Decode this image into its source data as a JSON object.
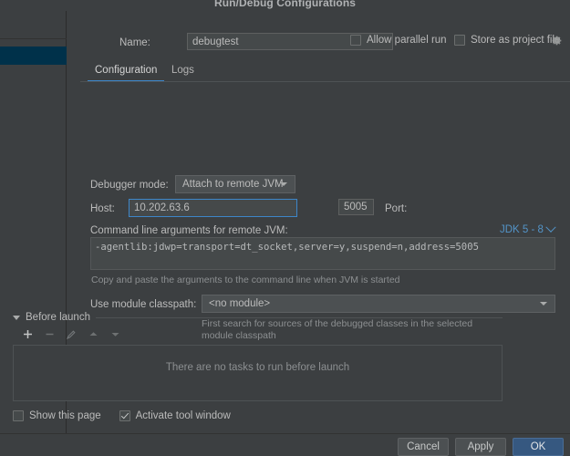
{
  "dialog": {
    "title": "Run/Debug Configurations"
  },
  "header": {
    "name_label": "Name:",
    "name_value": "debugtest",
    "allow_parallel_run_label": "Allow parallel run",
    "allow_parallel_run_checked": false,
    "store_as_project_file_label": "Store as project file",
    "store_as_project_file_checked": false,
    "gear_icon": "gear-icon"
  },
  "tabs": [
    {
      "label": "Configuration",
      "active": true
    },
    {
      "label": "Logs",
      "active": false
    }
  ],
  "form": {
    "debugger_mode_label": "Debugger mode:",
    "debugger_mode_value": "Attach to remote JVM",
    "host_label": "Host:",
    "host_value": "10.202.63.6",
    "port_label": "Port:",
    "port_value": "5005",
    "command_line_label": "Command line arguments for remote JVM:",
    "jdk_selector_label": "JDK 5 - 8",
    "command_line_value": "-agentlib:jdwp=transport=dt_socket,server=y,suspend=n,address=5005",
    "command_line_hint": "Copy and paste the arguments to the command line when JVM is started",
    "module_classpath_label": "Use module classpath:",
    "module_classpath_value": "<no module>",
    "module_classpath_hint": "First search for sources of the debugged classes in the selected module classpath"
  },
  "before_launch": {
    "section_title": "Before launch",
    "toolbar": [
      {
        "icon": "plus-icon",
        "enabled": true
      },
      {
        "icon": "minus-icon",
        "enabled": false
      },
      {
        "icon": "pencil-icon",
        "enabled": false
      },
      {
        "icon": "arrow-up-icon",
        "enabled": false
      },
      {
        "icon": "arrow-down-icon",
        "enabled": false
      }
    ],
    "empty_message": "There are no tasks to run before launch",
    "show_this_page_label": "Show this page",
    "show_this_page_checked": false,
    "activate_tool_window_label": "Activate tool window",
    "activate_tool_window_checked": true
  },
  "footer": {
    "cancel_label": "Cancel",
    "apply_label": "Apply",
    "ok_label": "OK"
  },
  "colors": {
    "background": "#3c3f41",
    "accent_blue": "#3d86c9",
    "link_blue": "#5394c8",
    "primary_button": "#365880",
    "selection": "#00314a"
  }
}
